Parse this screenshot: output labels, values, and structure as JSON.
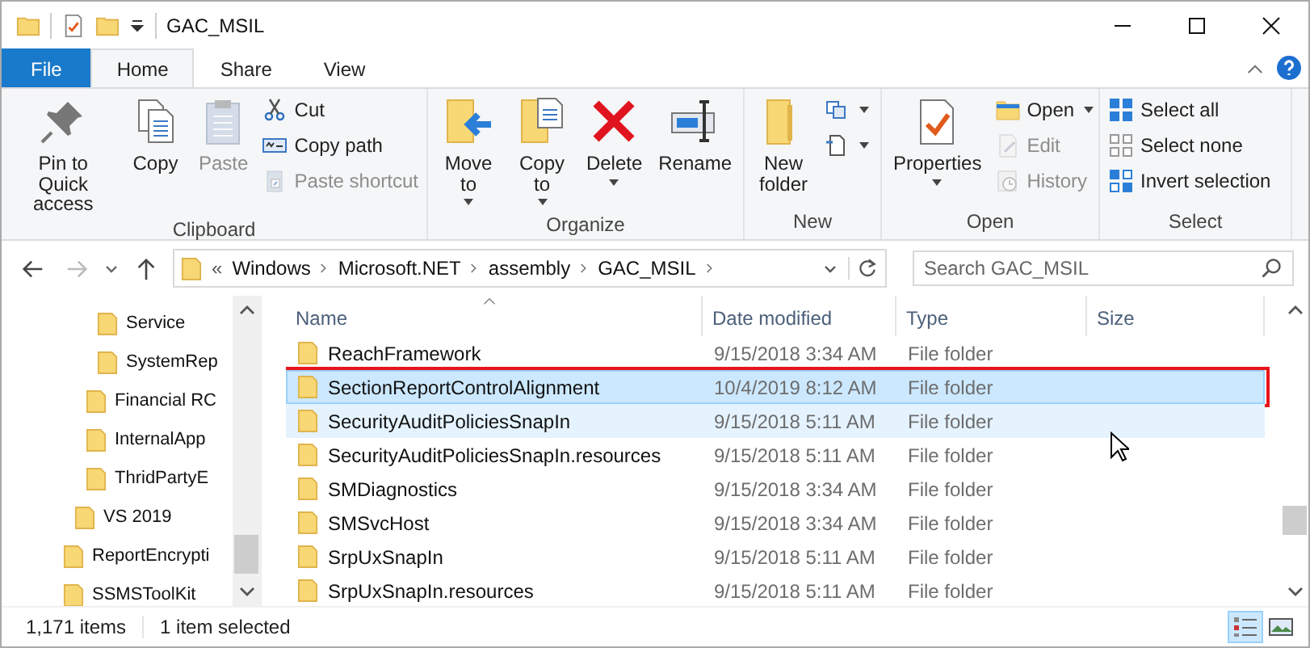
{
  "window": {
    "title": "GAC_MSIL"
  },
  "tabs": [
    {
      "label": "File",
      "kind": "file",
      "selected": false
    },
    {
      "label": "Home",
      "kind": "tab",
      "selected": true
    },
    {
      "label": "Share",
      "kind": "tab",
      "selected": false
    },
    {
      "label": "View",
      "kind": "tab",
      "selected": false
    }
  ],
  "ribbon": {
    "groups": [
      {
        "label": "Clipboard",
        "columns": [
          [
            {
              "kind": "large",
              "label": "Pin to Quick access",
              "disabled": false
            }
          ],
          [
            {
              "kind": "large",
              "label": "Copy",
              "disabled": false
            }
          ],
          [
            {
              "kind": "large",
              "label": "Paste",
              "disabled": true
            }
          ],
          [
            {
              "kind": "small",
              "label": "Cut",
              "disabled": false
            },
            {
              "kind": "small",
              "label": "Copy path",
              "disabled": false
            },
            {
              "kind": "small",
              "label": "Paste shortcut",
              "disabled": true
            }
          ]
        ]
      },
      {
        "label": "Organize",
        "columns": [
          [
            {
              "kind": "large",
              "label": "Move to",
              "dropdown": true,
              "disabled": false
            }
          ],
          [
            {
              "kind": "large",
              "label": "Copy to",
              "dropdown": true,
              "disabled": false
            }
          ],
          [
            {
              "kind": "large",
              "label": "Delete",
              "dropdown": true,
              "disabled": false
            }
          ],
          [
            {
              "kind": "large",
              "label": "Rename",
              "disabled": false
            }
          ]
        ]
      },
      {
        "label": "New",
        "columns": [
          [
            {
              "kind": "large",
              "label": "New folder",
              "disabled": false
            }
          ],
          [
            {
              "kind": "small",
              "dropdown": true,
              "disabled": false
            },
            {
              "kind": "small",
              "dropdown": true,
              "disabled": false
            }
          ]
        ]
      },
      {
        "label": "Open",
        "columns": [
          [
            {
              "kind": "large",
              "label": "Properties",
              "dropdown": true,
              "disabled": false
            }
          ],
          [
            {
              "kind": "small",
              "label": "Open",
              "dropdown": true,
              "disabled": false
            },
            {
              "kind": "small",
              "label": "Edit",
              "disabled": true
            },
            {
              "kind": "small",
              "label": "History",
              "disabled": true
            }
          ]
        ]
      },
      {
        "label": "Select",
        "columns": [
          [
            {
              "kind": "small",
              "label": "Select all",
              "disabled": false
            },
            {
              "kind": "small",
              "label": "Select none",
              "disabled": false
            },
            {
              "kind": "small",
              "label": "Invert selection",
              "disabled": false
            }
          ]
        ]
      }
    ]
  },
  "address": {
    "overflow": "«",
    "segments": [
      "Windows",
      "Microsoft.NET",
      "assembly",
      "GAC_MSIL"
    ]
  },
  "search": {
    "placeholder": "Search GAC_MSIL"
  },
  "nav_tree": [
    {
      "children": [
        {
          "children": [
            {
              "children": [
                {
                  "label": "Service"
                },
                {
                  "label": "SystemRep"
                }
              ]
            },
            {
              "label": "Financial RC"
            },
            {
              "label": "InternalApp"
            },
            {
              "label": "ThridPartyE"
            }
          ]
        },
        {
          "label": "VS 2019"
        }
      ]
    },
    {
      "label": "ReportEncrypti"
    },
    {
      "label": "SSMSToolKit"
    }
  ],
  "table": {
    "columns": [
      "Name",
      "Date modified",
      "Type",
      "Size"
    ],
    "rows": [
      {
        "name": "ReachFramework",
        "date": "9/15/2018 3:34 AM",
        "type": "File folder",
        "selected": false,
        "hovered": false,
        "annotated": false
      },
      {
        "name": "SectionReportControlAlignment",
        "date": "10/4/2019 8:12 AM",
        "type": "File folder",
        "selected": true,
        "hovered": false,
        "annotated": true
      },
      {
        "name": "SecurityAuditPoliciesSnapIn",
        "date": "9/15/2018 5:11 AM",
        "type": "File folder",
        "selected": false,
        "hovered": true,
        "annotated": false
      },
      {
        "name": "SecurityAuditPoliciesSnapIn.resources",
        "date": "9/15/2018 5:11 AM",
        "type": "File folder",
        "selected": false,
        "hovered": false,
        "annotated": false
      },
      {
        "name": "SMDiagnostics",
        "date": "9/15/2018 3:34 AM",
        "type": "File folder",
        "selected": false,
        "hovered": false,
        "annotated": false
      },
      {
        "name": "SMSvcHost",
        "date": "9/15/2018 3:34 AM",
        "type": "File folder",
        "selected": false,
        "hovered": false,
        "annotated": false
      },
      {
        "name": "SrpUxSnapIn",
        "date": "9/15/2018 5:11 AM",
        "type": "File folder",
        "selected": false,
        "hovered": false,
        "annotated": false
      },
      {
        "name": "SrpUxSnapIn.resources",
        "date": "9/15/2018 5:11 AM",
        "type": "File folder",
        "selected": false,
        "hovered": false,
        "annotated": false
      }
    ]
  },
  "status_bar": {
    "items_count": "1,171 items",
    "selection": "1 item selected"
  },
  "views": [
    {
      "selected": true
    },
    {
      "selected": false
    }
  ]
}
